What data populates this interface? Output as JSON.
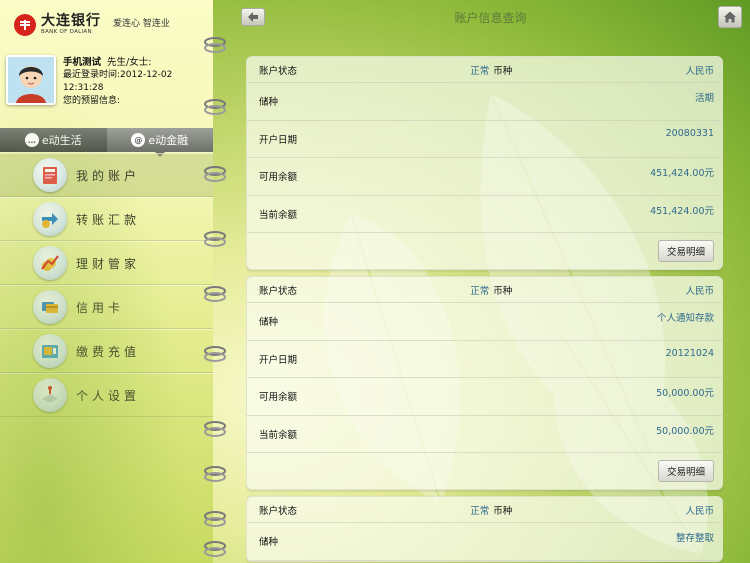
{
  "brand": {
    "name_cn": "大连银行",
    "name_en": "BANK OF DALIAN",
    "slogan": "爱连心 智连业"
  },
  "user": {
    "name": "手机测试",
    "salutation": "先生/女士:",
    "last_login_label": "最近登录时间:",
    "last_login_date": "2012-12-02",
    "last_login_time": "12:31:28",
    "reserved_label": "您的预留信息:"
  },
  "tabs": [
    {
      "label": "e动生活",
      "icon": "chat-icon",
      "active": false
    },
    {
      "label": "e动金融",
      "icon": "swirl-icon",
      "active": true
    }
  ],
  "menu": [
    {
      "label": "我的账户",
      "icon": "account-book-icon",
      "selected": true
    },
    {
      "label": "转账汇款",
      "icon": "transfer-icon",
      "selected": false
    },
    {
      "label": "理财管家",
      "icon": "coins-chart-icon",
      "selected": false
    },
    {
      "label": "信用卡",
      "icon": "credit-card-icon",
      "selected": false
    },
    {
      "label": "缴费充值",
      "icon": "bill-payment-icon",
      "selected": false
    },
    {
      "label": "个人设置",
      "icon": "settings-icon",
      "selected": false
    }
  ],
  "header": {
    "title": "账户信息查询",
    "back_icon": "back-arrow-icon",
    "home_icon": "home-icon"
  },
  "labels": {
    "account_status": "账户状态",
    "currency": "币种",
    "deposit_type": "储种",
    "open_date": "开户日期",
    "available_balance": "可用余额",
    "current_balance": "当前余额",
    "detail_button": "交易明细"
  },
  "accounts": [
    {
      "status": "正常",
      "currency": "人民币",
      "deposit_type": "活期",
      "open_date": "20080331",
      "available_balance": "451,424.00元",
      "current_balance": "451,424.00元"
    },
    {
      "status": "正常",
      "currency": "人民币",
      "deposit_type": "个人通知存款",
      "open_date": "20121024",
      "available_balance": "50,000.00元",
      "current_balance": "50,000.00元"
    },
    {
      "status": "正常",
      "currency": "人民币",
      "deposit_type": "整存整取"
    }
  ],
  "colors": {
    "accent_value": "#2e6a8e",
    "title": "#5c7a3a",
    "brand_red": "#d6231b"
  }
}
